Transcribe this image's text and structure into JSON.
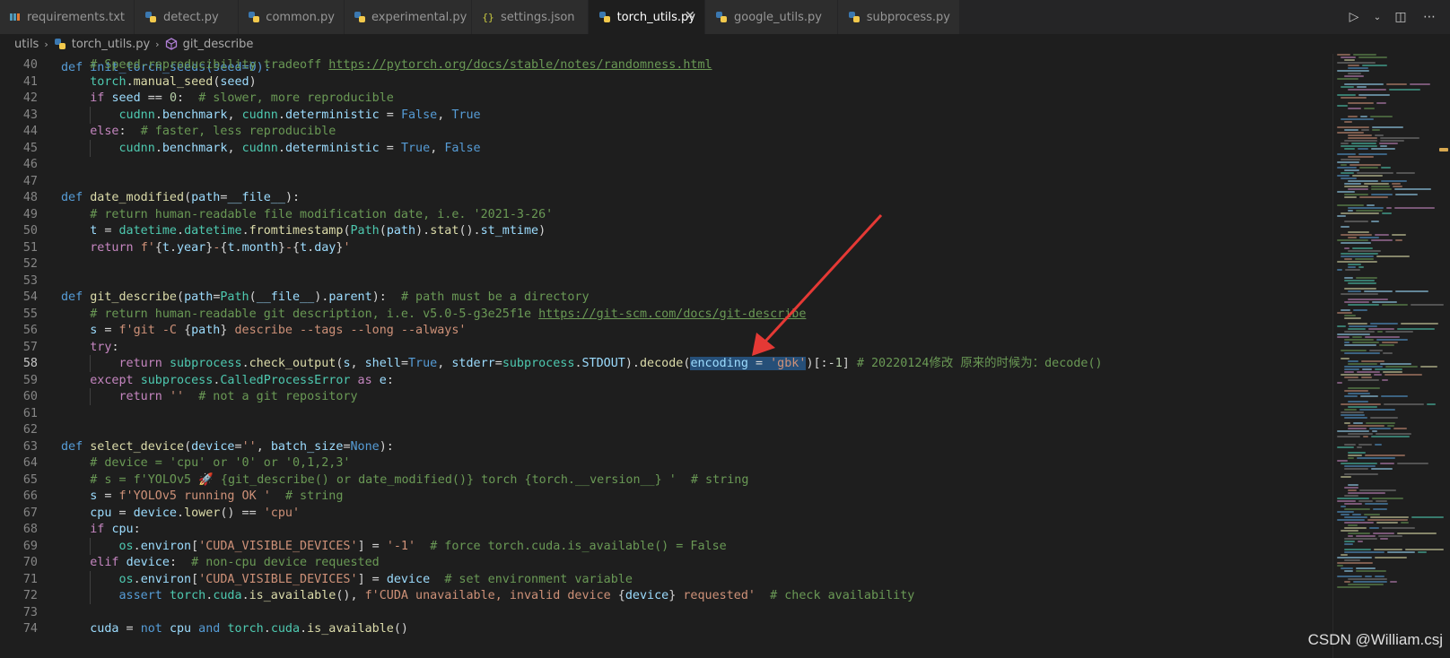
{
  "tabs": [
    {
      "label": "requirements.txt",
      "icon": "list-icon",
      "active": false
    },
    {
      "label": "detect.py",
      "icon": "python-icon",
      "active": false
    },
    {
      "label": "common.py",
      "icon": "python-icon",
      "active": false
    },
    {
      "label": "experimental.py",
      "icon": "python-icon",
      "active": false
    },
    {
      "label": "settings.json",
      "icon": "json-icon",
      "active": false
    },
    {
      "label": "torch_utils.py",
      "icon": "python-icon",
      "active": true
    },
    {
      "label": "google_utils.py",
      "icon": "python-icon",
      "active": false
    },
    {
      "label": "subprocess.py",
      "icon": "python-icon",
      "active": false
    }
  ],
  "breadcrumb": {
    "folder": "utils",
    "file": "torch_utils.py",
    "symbol": "git_describe"
  },
  "active_line": "58",
  "code_lines": [
    {
      "n": "40",
      "seg": [
        [
          "    ",
          ""
        ],
        [
          "# Speed-reproducibility tradeoff ",
          "c"
        ],
        [
          "https://pytorch.org/docs/stable/notes/randomness.html",
          "c u"
        ]
      ]
    },
    {
      "n": "41",
      "seg": [
        [
          "    ",
          ""
        ],
        [
          "torch",
          "t"
        ],
        [
          ".",
          ""
        ],
        [
          "manual_seed",
          "f"
        ],
        [
          "(",
          ""
        ],
        [
          "seed",
          "v"
        ],
        [
          ")",
          ""
        ]
      ]
    },
    {
      "n": "42",
      "seg": [
        [
          "    ",
          ""
        ],
        [
          "if ",
          "kc"
        ],
        [
          "seed",
          "v"
        ],
        [
          " == ",
          ""
        ],
        [
          "0",
          "n"
        ],
        [
          ":  ",
          ""
        ],
        [
          "# slower, more reproducible",
          "c"
        ]
      ]
    },
    {
      "n": "43",
      "seg": [
        [
          "        ",
          ""
        ],
        [
          "cudnn",
          "t"
        ],
        [
          ".",
          ""
        ],
        [
          "benchmark",
          "v"
        ],
        [
          ", ",
          ""
        ],
        [
          "cudnn",
          "t"
        ],
        [
          ".",
          ""
        ],
        [
          "deterministic",
          "v"
        ],
        [
          " = ",
          ""
        ],
        [
          "False",
          "k"
        ],
        [
          ", ",
          ""
        ],
        [
          "True",
          "k"
        ]
      ]
    },
    {
      "n": "44",
      "seg": [
        [
          "    ",
          ""
        ],
        [
          "else",
          "kc"
        ],
        [
          ":  ",
          ""
        ],
        [
          "# faster, less reproducible",
          "c"
        ]
      ]
    },
    {
      "n": "45",
      "seg": [
        [
          "        ",
          ""
        ],
        [
          "cudnn",
          "t"
        ],
        [
          ".",
          ""
        ],
        [
          "benchmark",
          "v"
        ],
        [
          ", ",
          ""
        ],
        [
          "cudnn",
          "t"
        ],
        [
          ".",
          ""
        ],
        [
          "deterministic",
          "v"
        ],
        [
          " = ",
          ""
        ],
        [
          "True",
          "k"
        ],
        [
          ", ",
          ""
        ],
        [
          "False",
          "k"
        ]
      ]
    },
    {
      "n": "46",
      "seg": []
    },
    {
      "n": "47",
      "seg": []
    },
    {
      "n": "48",
      "seg": [
        [
          "def ",
          "k"
        ],
        [
          "date_modified",
          "f"
        ],
        [
          "(",
          ""
        ],
        [
          "path",
          "v"
        ],
        [
          "=",
          ""
        ],
        [
          "__file__",
          "v"
        ],
        [
          "):",
          ""
        ]
      ]
    },
    {
      "n": "49",
      "seg": [
        [
          "    ",
          ""
        ],
        [
          "# return human-readable file modification date, i.e. '2021-3-26'",
          "c"
        ]
      ]
    },
    {
      "n": "50",
      "seg": [
        [
          "    ",
          ""
        ],
        [
          "t",
          "v"
        ],
        [
          " = ",
          ""
        ],
        [
          "datetime",
          "t"
        ],
        [
          ".",
          ""
        ],
        [
          "datetime",
          "t"
        ],
        [
          ".",
          ""
        ],
        [
          "fromtimestamp",
          "f"
        ],
        [
          "(",
          ""
        ],
        [
          "Path",
          "t"
        ],
        [
          "(",
          ""
        ],
        [
          "path",
          "v"
        ],
        [
          ").",
          ""
        ],
        [
          "stat",
          "f"
        ],
        [
          "().",
          ""
        ],
        [
          "st_mtime",
          "v"
        ],
        [
          ")",
          ""
        ]
      ]
    },
    {
      "n": "51",
      "seg": [
        [
          "    ",
          ""
        ],
        [
          "return ",
          "kc"
        ],
        [
          "f'",
          "s"
        ],
        [
          "{",
          ""
        ],
        [
          "t",
          "v"
        ],
        [
          ".",
          ""
        ],
        [
          "year",
          "v"
        ],
        [
          "}",
          ""
        ],
        [
          "-",
          "s"
        ],
        [
          "{",
          ""
        ],
        [
          "t",
          "v"
        ],
        [
          ".",
          ""
        ],
        [
          "month",
          "v"
        ],
        [
          "}",
          ""
        ],
        [
          "-",
          "s"
        ],
        [
          "{",
          ""
        ],
        [
          "t",
          "v"
        ],
        [
          ".",
          ""
        ],
        [
          "day",
          "v"
        ],
        [
          "}",
          ""
        ],
        [
          "'",
          "s"
        ]
      ]
    },
    {
      "n": "52",
      "seg": []
    },
    {
      "n": "53",
      "seg": []
    },
    {
      "n": "54",
      "seg": [
        [
          "def ",
          "k"
        ],
        [
          "git_describe",
          "f"
        ],
        [
          "(",
          ""
        ],
        [
          "path",
          "v"
        ],
        [
          "=",
          ""
        ],
        [
          "Path",
          "t"
        ],
        [
          "(",
          ""
        ],
        [
          "__file__",
          "v"
        ],
        [
          ").",
          ""
        ],
        [
          "parent",
          "v"
        ],
        [
          "):  ",
          ""
        ],
        [
          "# path must be a directory",
          "c"
        ]
      ]
    },
    {
      "n": "55",
      "seg": [
        [
          "    ",
          ""
        ],
        [
          "# return human-readable git description, i.e. v5.0-5-g3e25f1e ",
          "c"
        ],
        [
          "https://git-scm.com/docs/git-describe",
          "c u"
        ]
      ]
    },
    {
      "n": "56",
      "seg": [
        [
          "    ",
          ""
        ],
        [
          "s",
          "v"
        ],
        [
          " = ",
          ""
        ],
        [
          "f'git -C ",
          "s"
        ],
        [
          "{",
          ""
        ],
        [
          "path",
          "v"
        ],
        [
          "}",
          ""
        ],
        [
          " describe --tags --long --always'",
          "s"
        ]
      ]
    },
    {
      "n": "57",
      "seg": [
        [
          "    ",
          ""
        ],
        [
          "try",
          "kc"
        ],
        [
          ":",
          ""
        ]
      ]
    },
    {
      "n": "58",
      "seg": [
        [
          "        ",
          ""
        ],
        [
          "return ",
          "kc"
        ],
        [
          "subprocess",
          "t"
        ],
        [
          ".",
          ""
        ],
        [
          "check_output",
          "f"
        ],
        [
          "(",
          ""
        ],
        [
          "s",
          "v"
        ],
        [
          ", ",
          ""
        ],
        [
          "shell",
          "v"
        ],
        [
          "=",
          ""
        ],
        [
          "True",
          "k"
        ],
        [
          ", ",
          ""
        ],
        [
          "stderr",
          "v"
        ],
        [
          "=",
          ""
        ],
        [
          "subprocess",
          "t"
        ],
        [
          ".",
          ""
        ],
        [
          "STDOUT",
          "v"
        ],
        [
          ").",
          ""
        ],
        [
          "decode",
          "f"
        ],
        [
          "(",
          ""
        ],
        [
          "encoding",
          "v sel"
        ],
        [
          " = ",
          "sel"
        ],
        [
          "'gbk'",
          "s sel"
        ],
        [
          ")[:-",
          ""
        ],
        [
          "1",
          "n"
        ],
        [
          "] ",
          ""
        ],
        [
          "# 20220124修改 原来的时候为：decode()",
          "c"
        ]
      ]
    },
    {
      "n": "59",
      "seg": [
        [
          "    ",
          ""
        ],
        [
          "except ",
          "kc"
        ],
        [
          "subprocess",
          "t"
        ],
        [
          ".",
          ""
        ],
        [
          "CalledProcessError",
          "t"
        ],
        [
          " as ",
          "kc"
        ],
        [
          "e",
          "v"
        ],
        [
          ":",
          ""
        ]
      ]
    },
    {
      "n": "60",
      "seg": [
        [
          "        ",
          ""
        ],
        [
          "return ",
          "kc"
        ],
        [
          "''",
          "s"
        ],
        [
          "  ",
          ""
        ],
        [
          "# not a git repository",
          "c"
        ]
      ]
    },
    {
      "n": "61",
      "seg": []
    },
    {
      "n": "62",
      "seg": []
    },
    {
      "n": "63",
      "seg": [
        [
          "def ",
          "k"
        ],
        [
          "select_device",
          "f"
        ],
        [
          "(",
          ""
        ],
        [
          "device",
          "v"
        ],
        [
          "=",
          ""
        ],
        [
          "''",
          "s"
        ],
        [
          ", ",
          ""
        ],
        [
          "batch_size",
          "v"
        ],
        [
          "=",
          ""
        ],
        [
          "None",
          "k"
        ],
        [
          "):",
          ""
        ]
      ]
    },
    {
      "n": "64",
      "seg": [
        [
          "    ",
          ""
        ],
        [
          "# device = 'cpu' or '0' or '0,1,2,3'",
          "c"
        ]
      ]
    },
    {
      "n": "65",
      "seg": [
        [
          "    ",
          ""
        ],
        [
          "# s = f'YOLOv5 🚀 {git_describe() or date_modified()} torch {torch.__version__} '  # string",
          "c"
        ]
      ]
    },
    {
      "n": "66",
      "seg": [
        [
          "    ",
          ""
        ],
        [
          "s",
          "v"
        ],
        [
          " = ",
          ""
        ],
        [
          "f'YOLOv5 running OK '",
          "s"
        ],
        [
          "  ",
          ""
        ],
        [
          "# string",
          "c"
        ]
      ]
    },
    {
      "n": "67",
      "seg": [
        [
          "    ",
          ""
        ],
        [
          "cpu",
          "v"
        ],
        [
          " = ",
          ""
        ],
        [
          "device",
          "v"
        ],
        [
          ".",
          ""
        ],
        [
          "lower",
          "f"
        ],
        [
          "() == ",
          ""
        ],
        [
          "'cpu'",
          "s"
        ]
      ]
    },
    {
      "n": "68",
      "seg": [
        [
          "    ",
          ""
        ],
        [
          "if ",
          "kc"
        ],
        [
          "cpu",
          "v"
        ],
        [
          ":",
          ""
        ]
      ]
    },
    {
      "n": "69",
      "seg": [
        [
          "        ",
          ""
        ],
        [
          "os",
          "t"
        ],
        [
          ".",
          ""
        ],
        [
          "environ",
          "v"
        ],
        [
          "[",
          ""
        ],
        [
          "'CUDA_VISIBLE_DEVICES'",
          "s"
        ],
        [
          "] = ",
          ""
        ],
        [
          "'-1'",
          "s"
        ],
        [
          "  ",
          ""
        ],
        [
          "# force torch.cuda.is_available() = False",
          "c"
        ]
      ]
    },
    {
      "n": "70",
      "seg": [
        [
          "    ",
          ""
        ],
        [
          "elif ",
          "kc"
        ],
        [
          "device",
          "v"
        ],
        [
          ":  ",
          ""
        ],
        [
          "# non-cpu device requested",
          "c"
        ]
      ]
    },
    {
      "n": "71",
      "seg": [
        [
          "        ",
          ""
        ],
        [
          "os",
          "t"
        ],
        [
          ".",
          ""
        ],
        [
          "environ",
          "v"
        ],
        [
          "[",
          ""
        ],
        [
          "'CUDA_VISIBLE_DEVICES'",
          "s"
        ],
        [
          "] = ",
          ""
        ],
        [
          "device",
          "v"
        ],
        [
          "  ",
          ""
        ],
        [
          "# set environment variable",
          "c"
        ]
      ]
    },
    {
      "n": "72",
      "seg": [
        [
          "        ",
          ""
        ],
        [
          "assert ",
          "k"
        ],
        [
          "torch",
          "t"
        ],
        [
          ".",
          ""
        ],
        [
          "cuda",
          "t"
        ],
        [
          ".",
          ""
        ],
        [
          "is_available",
          "f"
        ],
        [
          "(), ",
          ""
        ],
        [
          "f'CUDA unavailable, invalid device ",
          "s"
        ],
        [
          "{",
          ""
        ],
        [
          "device",
          "v"
        ],
        [
          "}",
          ""
        ],
        [
          " requested'",
          "s"
        ],
        [
          "  ",
          ""
        ],
        [
          "# check availability",
          "c"
        ]
      ]
    },
    {
      "n": "73",
      "seg": []
    },
    {
      "n": "74",
      "seg": [
        [
          "    ",
          ""
        ],
        [
          "cuda",
          "v"
        ],
        [
          " = ",
          ""
        ],
        [
          "not ",
          "k"
        ],
        [
          "cpu",
          "v"
        ],
        [
          " and ",
          "k"
        ],
        [
          "torch",
          "t"
        ],
        [
          ".",
          ""
        ],
        [
          "cuda",
          "t"
        ],
        [
          ".",
          ""
        ],
        [
          "is_available",
          "f"
        ],
        [
          "()",
          ""
        ]
      ]
    }
  ],
  "partial_top_line": "def init_torch_seeds(seed=0):",
  "watermark": "CSDN @William.csj",
  "colors": {
    "arrow": "#e53935",
    "selection": "#264f78"
  }
}
